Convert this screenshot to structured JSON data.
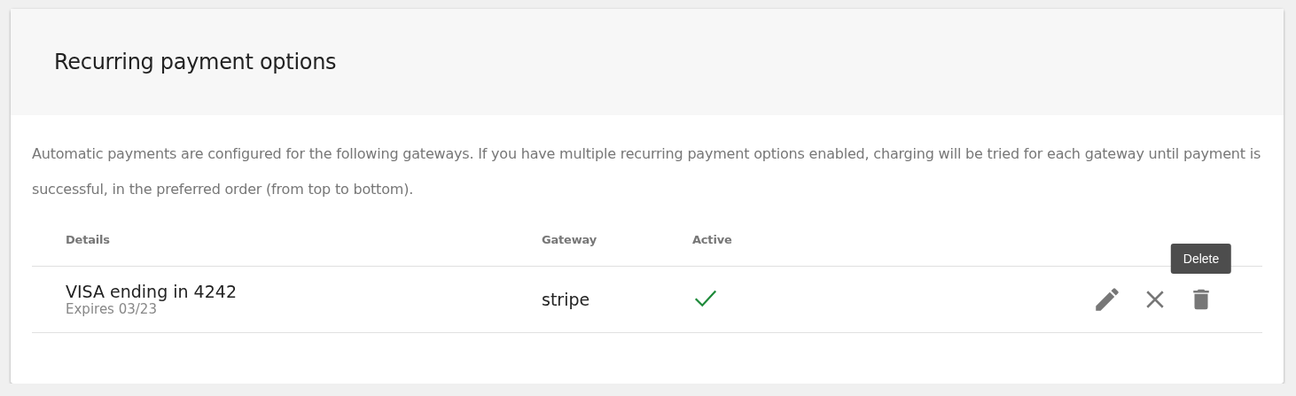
{
  "card": {
    "title": "Recurring payment options",
    "description": "Automatic payments are configured for the following gateways. If you have multiple recurring payment options enabled, charging will be tried for each gateway until payment is successful, in the preferred order (from top to bottom).",
    "table": {
      "columns": [
        "Details",
        "Gateway",
        "Active"
      ],
      "rows": [
        {
          "details": "VISA ending in 4242",
          "expires": "Expires 03/23",
          "gateway": "stripe",
          "active": true,
          "tooltip": "Delete"
        }
      ]
    }
  }
}
